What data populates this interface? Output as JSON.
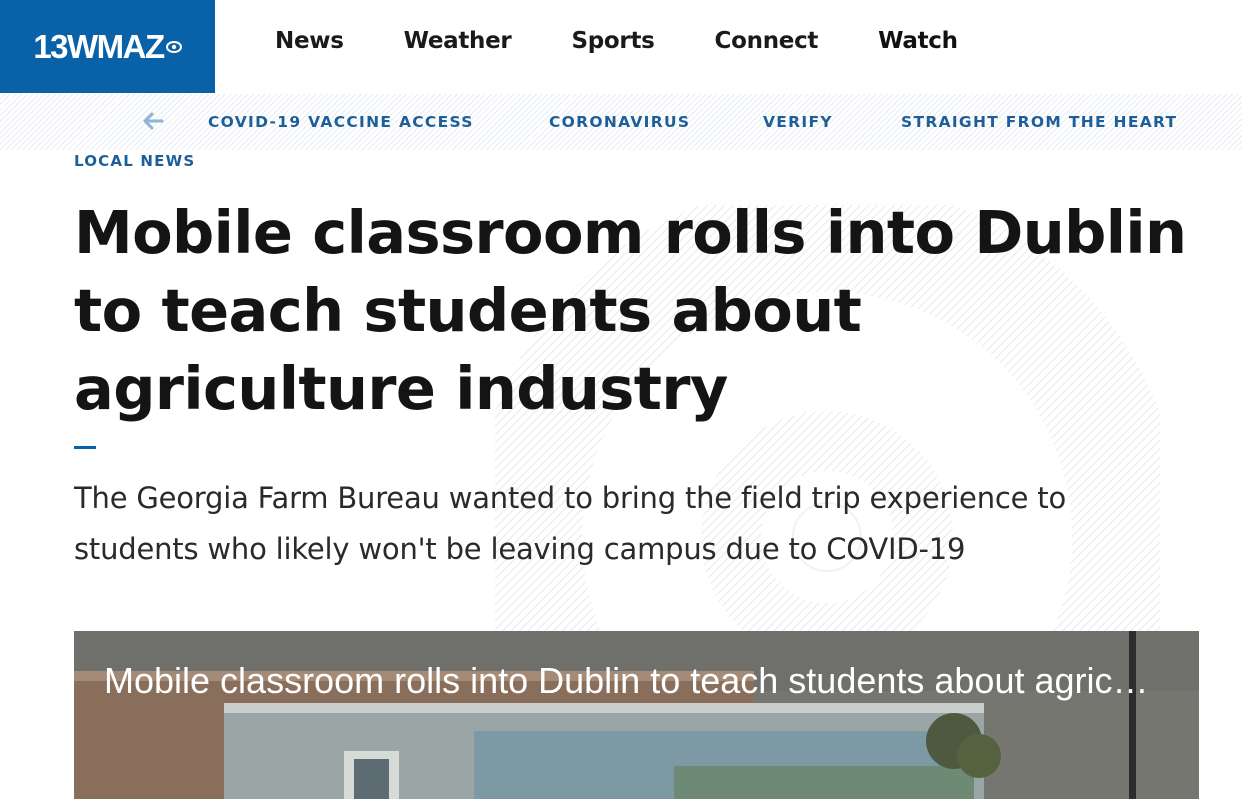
{
  "brand": {
    "logo_text": "13WMAZ",
    "logo_color": "#0961a8"
  },
  "nav": {
    "items": [
      {
        "label": "News"
      },
      {
        "label": "Weather"
      },
      {
        "label": "Sports"
      },
      {
        "label": "Connect"
      },
      {
        "label": "Watch"
      }
    ]
  },
  "subnav": {
    "links": [
      {
        "label": "COVID-19 VACCINE ACCESS"
      },
      {
        "label": "CORONAVIRUS"
      },
      {
        "label": "VERIFY"
      },
      {
        "label": "STRAIGHT FROM THE HEART"
      }
    ]
  },
  "article": {
    "section": "LOCAL NEWS",
    "headline": "Mobile classroom rolls into Dublin to teach students about agriculture industry",
    "summary": "The Georgia Farm Bureau wanted to bring the field trip experience to students who likely won't be leaving campus due to COVID-19"
  },
  "video": {
    "title": "Mobile classroom rolls into Dublin to teach students about agriculture industry"
  },
  "colors": {
    "accent": "#1f5f99",
    "text": "#141414"
  }
}
